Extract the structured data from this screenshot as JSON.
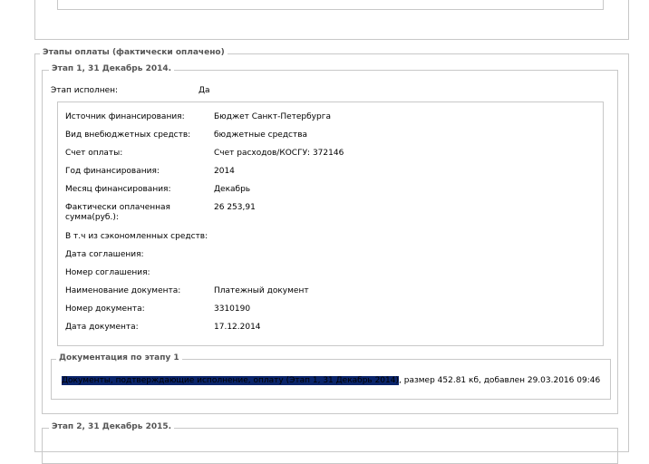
{
  "stages_section": {
    "legend": "Этапы оплаты (фактически оплачено)"
  },
  "stage1": {
    "legend": "Этап 1, 31 Декабрь 2014.",
    "completed_label": "Этап исполнен:",
    "completed_value": "Да",
    "fields": [
      {
        "label": "Источник финансирования:",
        "value": "Бюджет Санкт-Петербурга"
      },
      {
        "label": "Вид внебюджетных средств:",
        "value": "бюджетные средства"
      },
      {
        "label": "Счет оплаты:",
        "value": "Счет расходов/КОСГУ: 372146"
      },
      {
        "label": "Год финансирования:",
        "value": "2014"
      },
      {
        "label": "Месяц финансирования:",
        "value": "Декабрь"
      },
      {
        "label": "Фактически оплаченная сумма(руб.):",
        "value": "26 253,91"
      },
      {
        "label": "В т.ч из сэкономленных средств:",
        "value": ""
      },
      {
        "label": "Дата соглашения:",
        "value": ""
      },
      {
        "label": "Номер соглашения:",
        "value": ""
      },
      {
        "label": "Наименование документа:",
        "value": "Платежный документ"
      },
      {
        "label": "Номер документа:",
        "value": "3310190"
      },
      {
        "label": "Дата документа:",
        "value": "17.12.2014"
      }
    ],
    "documentation": {
      "legend": "Документация по этапу 1",
      "link_text": "Документы, подтверждающие исполнение, оплату (Этап 1, 31 Декабрь 2014)",
      "info": ", размер 452.81 кб, добавлен 29.03.2016 09:46"
    }
  },
  "stage2": {
    "legend": "Этап 2, 31 Декабрь 2015."
  }
}
